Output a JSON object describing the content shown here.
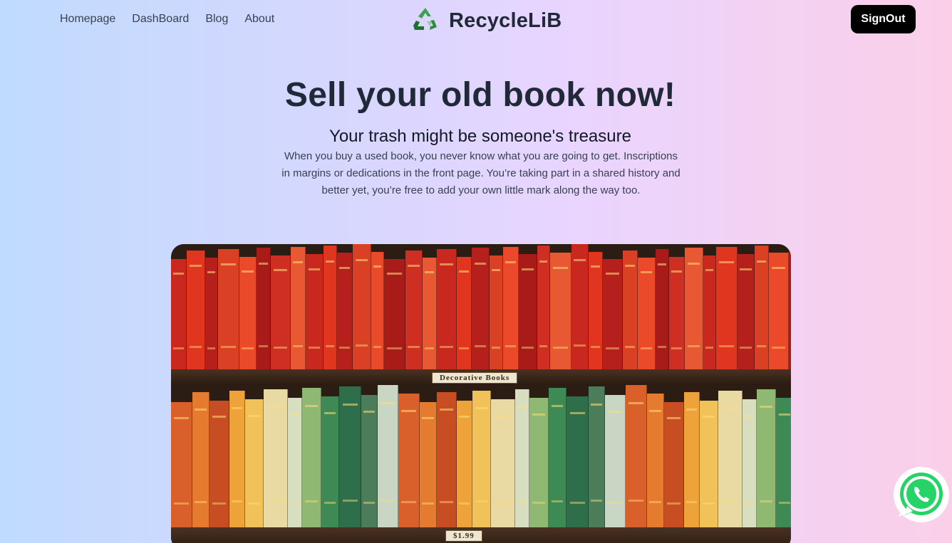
{
  "nav": {
    "links": [
      "Homepage",
      "DashBoard",
      "Blog",
      "About"
    ],
    "brand": "RecycleLiB",
    "signout_label": "SignOut"
  },
  "hero": {
    "title": "Sell your old book now!",
    "subtitle": "Your trash might be someone's treasure",
    "text": "When you buy a used book, you never know what you are going to get. Inscriptions in margins or dedications in the front page. You’re taking part in a shared history and better yet, you’re free to add your own little mark along the way too."
  },
  "image": {
    "shelf_label": "Decorative Books",
    "price_label": "$1.99"
  },
  "icons": {
    "logo": "recycle-icon",
    "chat": "whatsapp-icon"
  },
  "colors": {
    "signout_bg": "#000000",
    "logo_green": "#2e8b3e",
    "whatsapp_green": "#25d366"
  }
}
